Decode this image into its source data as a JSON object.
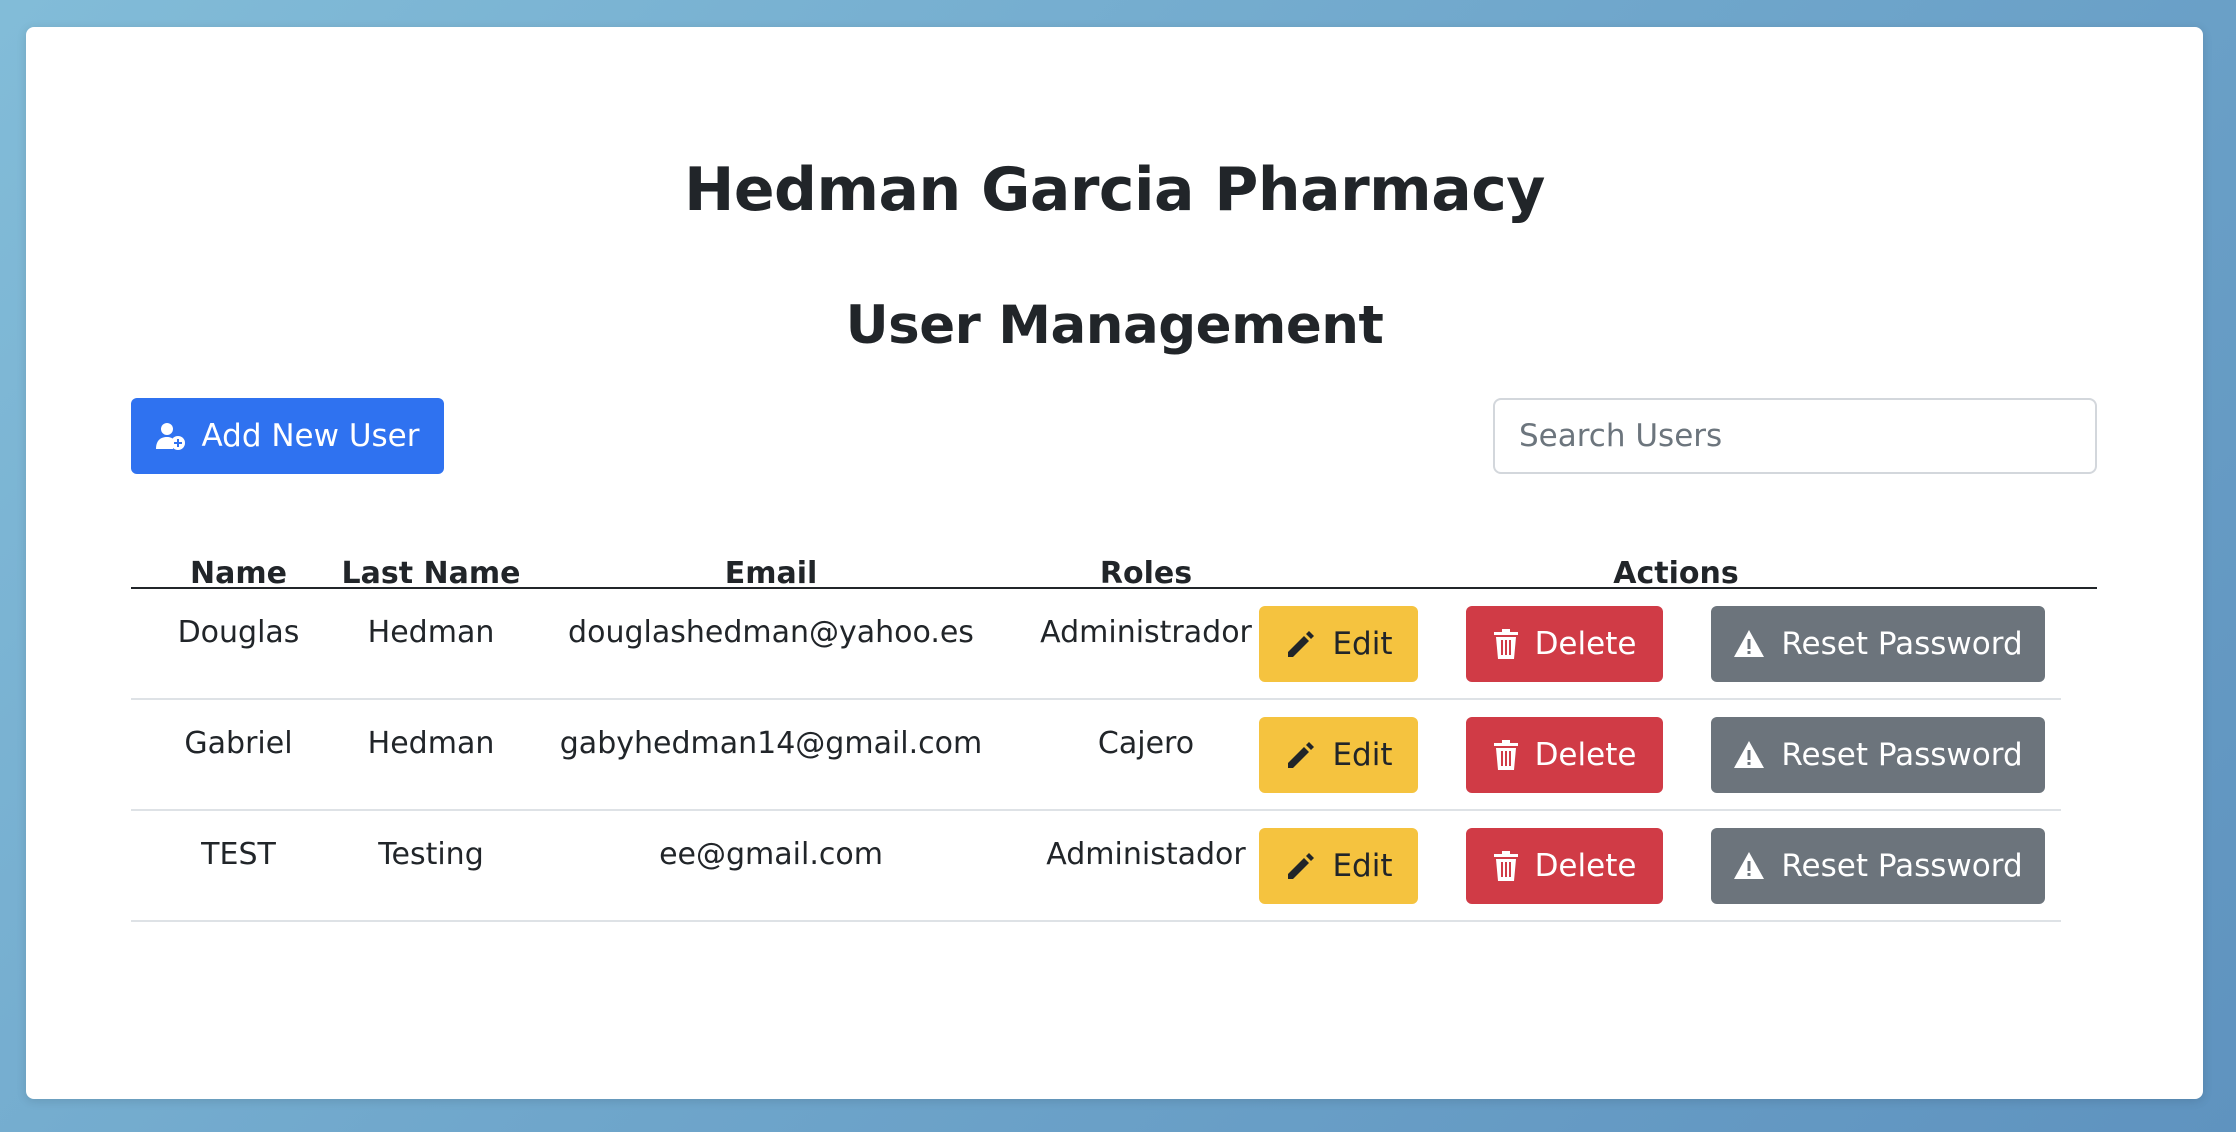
{
  "header": {
    "title": "Hedman Garcia Pharmacy",
    "subtitle": "User Management"
  },
  "toolbar": {
    "add_label": "Add New User",
    "add_icon": "user-plus-icon",
    "search_placeholder": "Search Users",
    "search_value": ""
  },
  "table": {
    "columns": [
      "Name",
      "Last Name",
      "Email",
      "Roles",
      "Actions"
    ],
    "rows": [
      {
        "name": "Douglas",
        "last_name": "Hedman",
        "email": "douglashedman@yahoo.es",
        "role": "Administrador"
      },
      {
        "name": "Gabriel",
        "last_name": "Hedman",
        "email": "gabyhedman14@gmail.com",
        "role": "Cajero"
      },
      {
        "name": "TEST",
        "last_name": "Testing",
        "email": "ee@gmail.com",
        "role": "Administador"
      }
    ],
    "actions": {
      "edit_label": "Edit",
      "delete_label": "Delete",
      "reset_label": "Reset Password"
    }
  },
  "colors": {
    "primary": "#2f72f0",
    "warning": "#f5c33f",
    "danger": "#d03b46",
    "secondary": "#6c747c"
  }
}
